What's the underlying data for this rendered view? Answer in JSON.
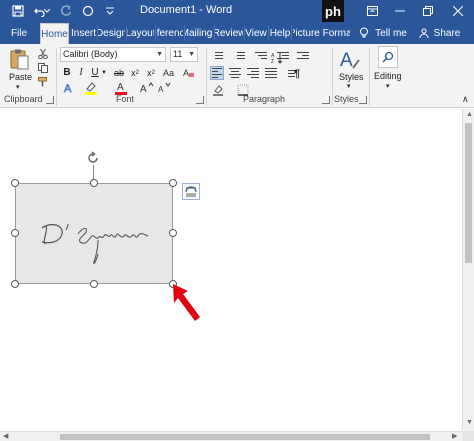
{
  "window": {
    "title": "Document1 - Word",
    "brand_logo": "ph"
  },
  "titlebar_icons": [
    "save-icon",
    "undo-icon",
    "undo-dropdown-icon",
    "redo-icon",
    "circle-icon",
    "customize-quick-access-icon"
  ],
  "tabs": [
    {
      "label": "File"
    },
    {
      "label": "Home",
      "active": true
    },
    {
      "label": "Insert"
    },
    {
      "label": "Design"
    },
    {
      "label": "Layout"
    },
    {
      "label": "References"
    },
    {
      "label": "Mailings"
    },
    {
      "label": "Review"
    },
    {
      "label": "View"
    },
    {
      "label": "Help"
    },
    {
      "label": "Picture Format"
    }
  ],
  "tell_me": "Tell me",
  "share": "Share",
  "ribbon": {
    "clipboard": {
      "label": "Clipboard",
      "paste": "Paste"
    },
    "font": {
      "label": "Font",
      "font_name": "Calibri (Body)",
      "font_size": "11",
      "bold": "B",
      "italic": "I",
      "underline": "U"
    },
    "paragraph": {
      "label": "Paragraph"
    },
    "styles": {
      "label": "Styles",
      "button": "Styles"
    },
    "editing": {
      "button": "Editing"
    }
  },
  "colors": {
    "accent": "#2b579a",
    "ribbon_bg": "#f3f3f3",
    "highlight": "#ffff00",
    "font_color": "#e81123",
    "arrow": "#e00010"
  },
  "document": {
    "picture": {
      "content": "handwritten signature",
      "selected": true
    }
  }
}
